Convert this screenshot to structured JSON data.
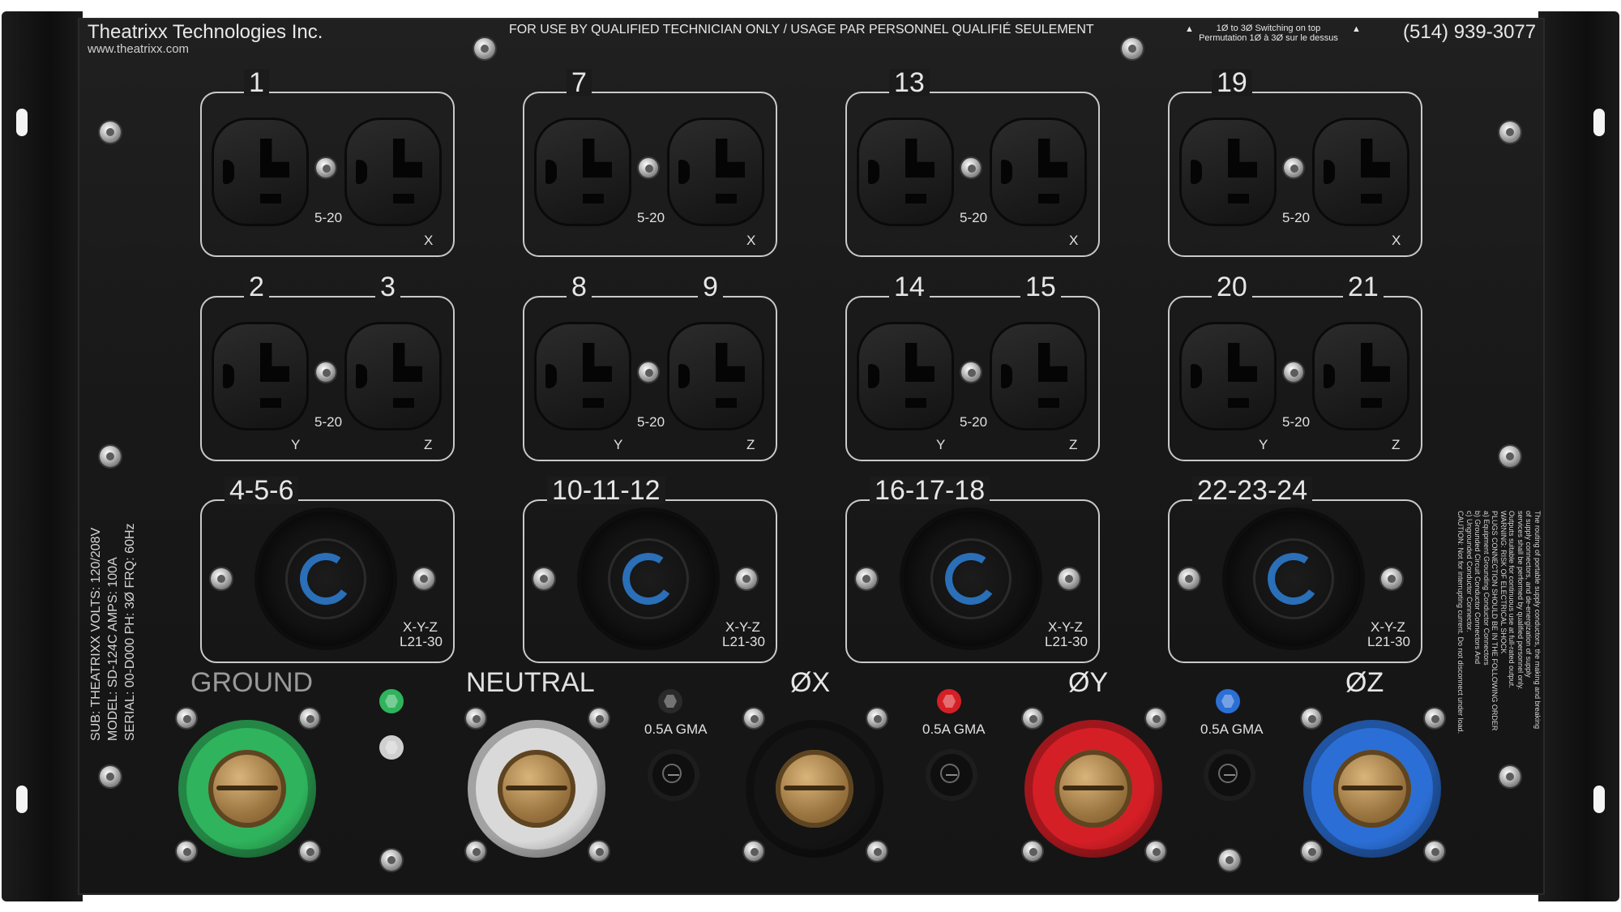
{
  "header": {
    "company": "Theatrixx Technologies Inc.",
    "website": "www.theatrixx.com",
    "warning": "FOR USE BY QUALIFIED TECHNICIAN ONLY / USAGE PAR PERSONNEL QUALIFIÉ SEULEMENT",
    "switch_note_en": "1Ø to 3Ø Switching on top",
    "switch_note_fr": "Permutation 1Ø à 3Ø sur le dessus",
    "phone": "(514) 939-3077"
  },
  "spec_label": {
    "line1": "SUB: THEATRIXX   VOLTS: 120/208V",
    "line2": "MODEL: SD-124C   AMPS: 100A",
    "line3": "SERIAL: 00-D000   PH: 3Ø  FRQ: 60Hz"
  },
  "duplex_groups": [
    {
      "num_left": "1",
      "num_right": "",
      "type": "5-20",
      "phase_left": "",
      "phase_right": "X"
    },
    {
      "num_left": "7",
      "num_right": "",
      "type": "5-20",
      "phase_left": "",
      "phase_right": "X"
    },
    {
      "num_left": "13",
      "num_right": "",
      "type": "5-20",
      "phase_left": "",
      "phase_right": "X"
    },
    {
      "num_left": "19",
      "num_right": "",
      "type": "5-20",
      "phase_left": "",
      "phase_right": "X"
    },
    {
      "num_left": "2",
      "num_right": "3",
      "type": "5-20",
      "phase_left": "Y",
      "phase_right": "Z"
    },
    {
      "num_left": "8",
      "num_right": "9",
      "type": "5-20",
      "phase_left": "Y",
      "phase_right": "Z"
    },
    {
      "num_left": "14",
      "num_right": "15",
      "type": "5-20",
      "phase_left": "Y",
      "phase_right": "Z"
    },
    {
      "num_left": "20",
      "num_right": "21",
      "type": "5-20",
      "phase_left": "Y",
      "phase_right": "Z"
    }
  ],
  "twistlock_groups": [
    {
      "label": "4-5-6",
      "phase": "X-Y-Z",
      "type": "L21-30"
    },
    {
      "label": "10-11-12",
      "phase": "X-Y-Z",
      "type": "L21-30"
    },
    {
      "label": "16-17-18",
      "phase": "X-Y-Z",
      "type": "L21-30"
    },
    {
      "label": "22-23-24",
      "phase": "X-Y-Z",
      "type": "L21-30"
    }
  ],
  "feeders": [
    {
      "label": "GROUND",
      "color": "#2fb35c"
    },
    {
      "label": "NEUTRAL",
      "color": "#d9d9d9"
    },
    {
      "label": "ØX",
      "color": "#141414"
    },
    {
      "label": "ØY",
      "color": "#d51f26"
    },
    {
      "label": "ØZ",
      "color": "#2b6fd6"
    }
  ],
  "gma_labels": [
    "0.5A GMA",
    "0.5A GMA",
    "0.5A GMA"
  ],
  "indicator_colors": {
    "ground": "#2fb35c",
    "x": "#2a2a2a",
    "y": "#d51f26",
    "z": "#2b6fd6",
    "neutral": "#cfcfcf"
  },
  "side_notice": [
    "The routing of portable supply conductors, the making and breaking",
    "of supply connectors, and de-energization of supply",
    "services shall be performed by qualified personnel only.",
    "Outputs suitable for continuous use at full-rated output.",
    "WARNING: RISK OF ELECTRICAL SHOCK",
    "PLUGS CONNECTION SHOULD BE IN THE FOLLOWING ORDER",
    "a) Equipment Grounding Conductor Connectors",
    "b) Grounded Circuit Conductor Connectors And",
    "c) Ungrounded Conductor Connector.",
    "CAUTION: Not for interrupting current. Do not disconnect under load."
  ]
}
